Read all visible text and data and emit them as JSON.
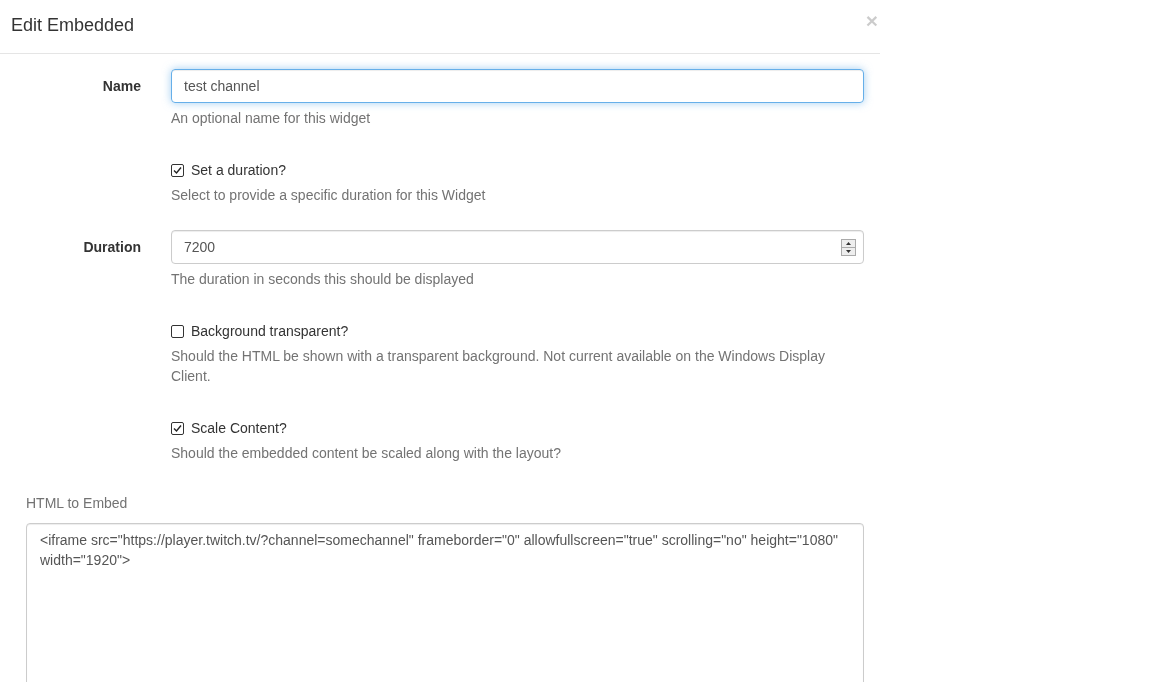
{
  "dialog": {
    "title": "Edit Embedded",
    "close": "×"
  },
  "fields": [
    {
      "kind": "text",
      "label": "Name",
      "value": "test channel",
      "focused": true,
      "help": "An optional name for this widget"
    },
    {
      "kind": "checkbox",
      "label": "Set a duration?",
      "checked": true,
      "help": "Select to provide a specific duration for this Widget"
    },
    {
      "kind": "number",
      "label": "Duration",
      "value": "7200",
      "focused": false,
      "help": "The duration in seconds this should be displayed"
    },
    {
      "kind": "checkbox",
      "label": "Background transparent?",
      "checked": false,
      "help": "Should the HTML be shown with a transparent background. Not current available on the Windows Display Client."
    },
    {
      "kind": "checkbox",
      "label": "Scale Content?",
      "checked": true,
      "help": "Should the embedded content be scaled along with the layout?"
    },
    {
      "kind": "textarea",
      "label": "HTML to Embed",
      "value": "<iframe src=\"https://player.twitch.tv/?channel=somechannel\" frameborder=\"0\" allowfullscreen=\"true\" scrolling=\"no\" height=\"1080\" width=\"1920\">"
    }
  ]
}
